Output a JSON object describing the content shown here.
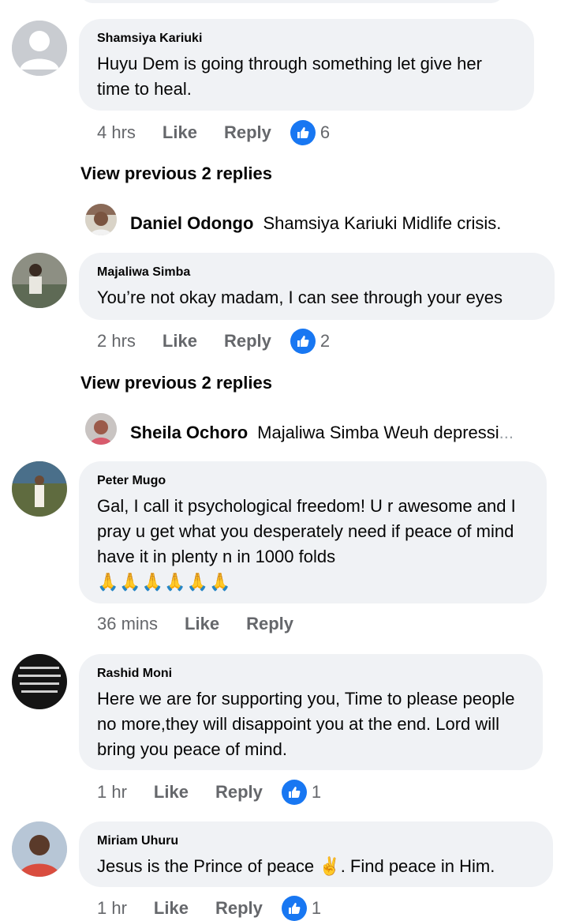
{
  "comments": [
    {
      "author": "Shamsiya Kariuki",
      "text": "Huyu Dem is going through something let give her time to heal.",
      "time": "4 hrs",
      "like_label": "Like",
      "reply_label": "Reply",
      "reactions": "6"
    },
    {
      "author": "Majaliwa Simba",
      "text": "You’re not okay madam, I can see through your eyes",
      "time": "2 hrs",
      "like_label": "Like",
      "reply_label": "Reply",
      "reactions": "2"
    },
    {
      "author": "Peter Mugo",
      "text": "Gal, I call it psychological freedom! U r awesome and I pray u get what you desperately need if peace of mind have it in plenty n in 1000 folds",
      "emoji": "🙏🙏🙏🙏🙏🙏",
      "time": "36 mins",
      "like_label": "Like",
      "reply_label": "Reply"
    },
    {
      "author": "Rashid Moni",
      "text": "Here we are for supporting you, Time to please people no more,they will disappoint you at the end. Lord will bring you peace of mind.",
      "time": "1 hr",
      "like_label": "Like",
      "reply_label": "Reply",
      "reactions": "1"
    },
    {
      "author": "Miriam Uhuru",
      "text_before": "Jesus is the Prince of peace",
      "emoji": "✌️",
      "text_after": ". Find peace in Him.",
      "time": "1 hr",
      "like_label": "Like",
      "reply_label": "Reply",
      "reactions": "1"
    }
  ],
  "threads": [
    {
      "view_previous": "View previous 2 replies",
      "reply_author": "Daniel Odongo",
      "reply_text": "Shamsiya Kariuki Midlife crisis."
    },
    {
      "view_previous": "View previous 2 replies",
      "reply_author": "Sheila Ochoro",
      "reply_text": "Majaliwa Simba Weuh depressi",
      "ellipsis": "..."
    }
  ],
  "colors": {
    "bubble_bg": "#f0f2f5",
    "meta_text": "#65676b",
    "like_blue": "#1877f2"
  }
}
